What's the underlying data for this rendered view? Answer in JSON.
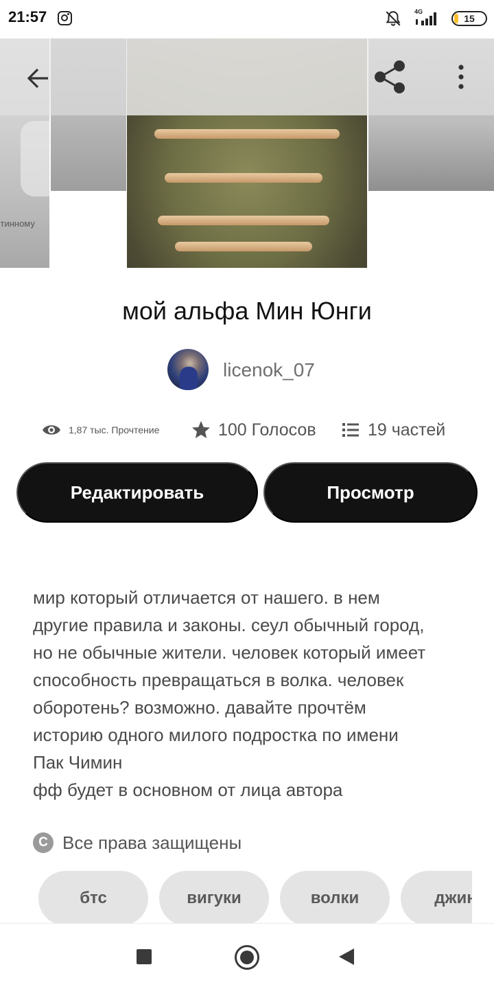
{
  "status_bar": {
    "time": "21:57",
    "network": "4G",
    "battery": "15",
    "icons": [
      "instagram-icon",
      "bell-off-icon",
      "signal-icon",
      "battery-icon"
    ]
  },
  "cover": {
    "left_cover_text": "стинному"
  },
  "toolbar": {
    "back_icon": "arrow-left-icon",
    "share_icon": "share-icon",
    "more_icon": "more-vertical-icon"
  },
  "story": {
    "title": "мой альфа Мин Юнги",
    "author": "licenok_07",
    "reads": "1,87 тыс. Прочтение",
    "votes": "100 Голосов",
    "parts": "19 частей",
    "description": "мир который отличается от нашего. в нем\nдругие правила и законы. сеул обычный город,\nно не обычные жители. человек который имеет\nспособность превращаться в волка. человек\nоборотень? возможно. давайте прочтём\nисторию одного милого подростка по имени\nПак Чимин\nфф будет в основном от лица автора",
    "copyright": "Все права защищены"
  },
  "actions": {
    "edit_label": "Редактировать",
    "view_label": "Просмотр"
  },
  "tags": [
    "бтс",
    "вигуки",
    "волки",
    "джин"
  ],
  "colors": {
    "button_bg": "#121212",
    "tag_bg": "#e4e4e4",
    "battery_accent": "#fbc02d"
  }
}
